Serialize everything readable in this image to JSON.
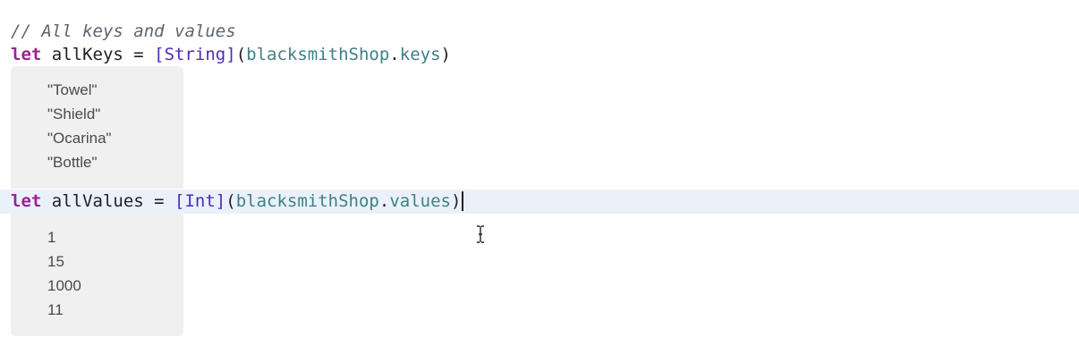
{
  "editor": {
    "comment": "// All keys and values",
    "keys_line": {
      "keyword": "let",
      "name": " allKeys = ",
      "type": "[String]",
      "open": "(",
      "object": "blacksmithShop",
      "dot": ".",
      "property": "keys",
      "close": ")"
    },
    "values_line": {
      "keyword": "let",
      "name": " allValues = ",
      "type": "[Int]",
      "open": "(",
      "object": "blacksmithShop",
      "dot": ".",
      "property": "values",
      "close": ")"
    }
  },
  "results": {
    "keys": [
      "\"Towel\"",
      "\"Shield\"",
      "\"Ocarina\"",
      "\"Bottle\""
    ],
    "values": [
      "1",
      "15",
      "1000",
      "11"
    ]
  },
  "colors": {
    "keyword": "#9b2393",
    "type": "#4b2bb8",
    "call": "#3e8087",
    "comment": "#5c6670",
    "line_highlight": "#ebf1fb",
    "result_panel": "#f0f0f1"
  },
  "icons": {
    "cursor": "text-cursor-icon"
  }
}
